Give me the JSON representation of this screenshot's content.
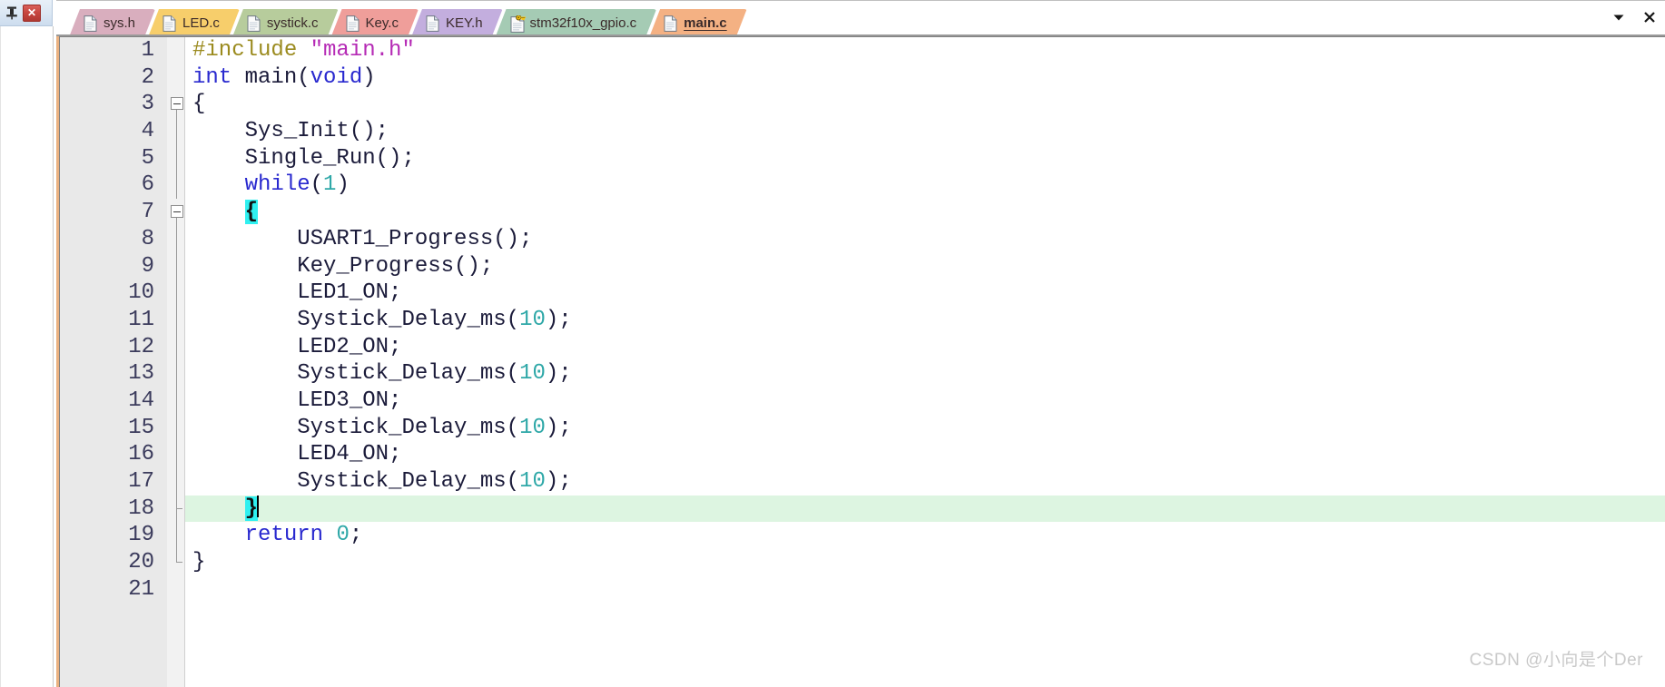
{
  "panel": {
    "pin_icon": "pin-icon",
    "close_label": "✕"
  },
  "window_controls": {
    "dropdown_label": "▼",
    "close_label": "✕"
  },
  "tabs": [
    {
      "label": "sys.h",
      "color": "#d9aebe",
      "icon": "file-icon",
      "active": false
    },
    {
      "label": "LED.c",
      "color": "#f7ce6b",
      "icon": "file-icon",
      "active": false
    },
    {
      "label": "systick.c",
      "color": "#b7cc9c",
      "icon": "file-icon",
      "active": false
    },
    {
      "label": "Key.c",
      "color": "#ef9e9a",
      "icon": "file-icon",
      "active": false
    },
    {
      "label": "KEY.h",
      "color": "#c3aede",
      "icon": "file-icon",
      "active": false
    },
    {
      "label": "stm32f10x_gpio.c",
      "color": "#a5cbb4",
      "icon": "file-key-icon",
      "active": false
    },
    {
      "label": "main.c",
      "color": "#f4b183",
      "icon": "file-icon",
      "active": true
    }
  ],
  "editor": {
    "current_line": 18,
    "current_line_color": "#ddf5e1",
    "brace_match_color": "#2ff0f0",
    "gutter_color": "#e9e9e9",
    "lines": [
      {
        "n": "1",
        "fold": "none",
        "tokens": [
          {
            "t": "#include ",
            "c": "pre"
          },
          {
            "t": "\"main.h\"",
            "c": "str"
          }
        ]
      },
      {
        "n": "2",
        "fold": "none",
        "tokens": [
          {
            "t": "int",
            "c": "kw"
          },
          {
            "t": " main(",
            "c": "id"
          },
          {
            "t": "void",
            "c": "kw"
          },
          {
            "t": ")",
            "c": "id"
          }
        ]
      },
      {
        "n": "3",
        "fold": "start",
        "tokens": [
          {
            "t": "{",
            "c": "id"
          }
        ]
      },
      {
        "n": "4",
        "fold": "line",
        "tokens": [
          {
            "t": "    Sys_Init();",
            "c": "id"
          }
        ]
      },
      {
        "n": "5",
        "fold": "line",
        "tokens": [
          {
            "t": "    Single_Run();",
            "c": "id"
          }
        ]
      },
      {
        "n": "6",
        "fold": "line",
        "tokens": [
          {
            "t": "    ",
            "c": "id"
          },
          {
            "t": "while",
            "c": "kw"
          },
          {
            "t": "(",
            "c": "id"
          },
          {
            "t": "1",
            "c": "num"
          },
          {
            "t": ")",
            "c": "id"
          }
        ]
      },
      {
        "n": "7",
        "fold": "start2",
        "tokens": [
          {
            "t": "    ",
            "c": "id"
          },
          {
            "t": "{",
            "c": "brace"
          }
        ]
      },
      {
        "n": "8",
        "fold": "line",
        "tokens": [
          {
            "t": "        USART1_Progress();",
            "c": "id"
          }
        ]
      },
      {
        "n": "9",
        "fold": "line",
        "tokens": [
          {
            "t": "        Key_Progress();",
            "c": "id"
          }
        ]
      },
      {
        "n": "10",
        "fold": "line",
        "tokens": [
          {
            "t": "        LED1_ON;",
            "c": "id"
          }
        ]
      },
      {
        "n": "11",
        "fold": "line",
        "tokens": [
          {
            "t": "        Systick_Delay_ms(",
            "c": "id"
          },
          {
            "t": "10",
            "c": "num"
          },
          {
            "t": ");",
            "c": "id"
          }
        ]
      },
      {
        "n": "12",
        "fold": "line",
        "tokens": [
          {
            "t": "        LED2_ON;",
            "c": "id"
          }
        ]
      },
      {
        "n": "13",
        "fold": "line",
        "tokens": [
          {
            "t": "        Systick_Delay_ms(",
            "c": "id"
          },
          {
            "t": "10",
            "c": "num"
          },
          {
            "t": ");",
            "c": "id"
          }
        ]
      },
      {
        "n": "14",
        "fold": "line",
        "tokens": [
          {
            "t": "        LED3_ON;",
            "c": "id"
          }
        ]
      },
      {
        "n": "15",
        "fold": "line",
        "tokens": [
          {
            "t": "        Systick_Delay_ms(",
            "c": "id"
          },
          {
            "t": "10",
            "c": "num"
          },
          {
            "t": ");",
            "c": "id"
          }
        ]
      },
      {
        "n": "16",
        "fold": "line",
        "tokens": [
          {
            "t": "        LED4_ON;",
            "c": "id"
          }
        ]
      },
      {
        "n": "17",
        "fold": "line",
        "tokens": [
          {
            "t": "        Systick_Delay_ms(",
            "c": "id"
          },
          {
            "t": "10",
            "c": "num"
          },
          {
            "t": ");",
            "c": "id"
          }
        ]
      },
      {
        "n": "18",
        "fold": "end2",
        "tokens": [
          {
            "t": "    ",
            "c": "id"
          },
          {
            "t": "}",
            "c": "brace"
          },
          {
            "t": "",
            "c": "caret"
          }
        ]
      },
      {
        "n": "19",
        "fold": "line",
        "tokens": [
          {
            "t": "    ",
            "c": "id"
          },
          {
            "t": "return",
            "c": "kw"
          },
          {
            "t": " ",
            "c": "id"
          },
          {
            "t": "0",
            "c": "num"
          },
          {
            "t": ";",
            "c": "id"
          }
        ]
      },
      {
        "n": "20",
        "fold": "end",
        "tokens": [
          {
            "t": "}",
            "c": "id"
          }
        ]
      },
      {
        "n": "21",
        "fold": "none",
        "tokens": []
      }
    ]
  },
  "watermark": {
    "text": "CSDN @小向是个Der"
  }
}
